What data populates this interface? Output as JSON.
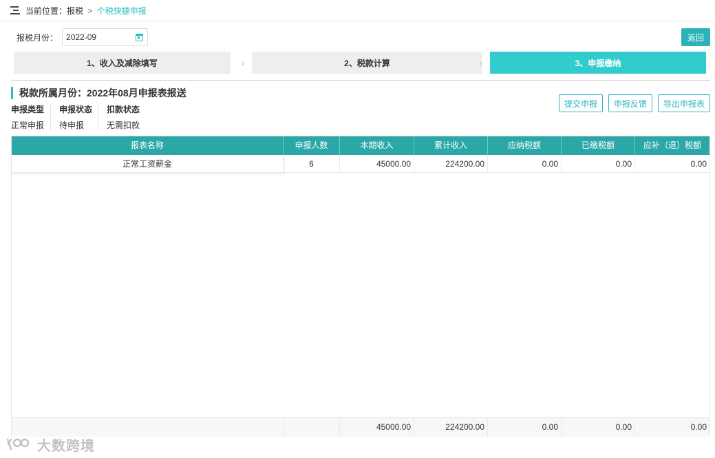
{
  "breadcrumb": {
    "prefix": "当前位置：报税",
    "separator": ">",
    "current": "个税快捷申报"
  },
  "filter": {
    "month_label": "报税月份：",
    "month_value": "2022-09"
  },
  "back_button": "返回",
  "steps": [
    {
      "label": "1、收入及减除填写",
      "active": false
    },
    {
      "label": "2、税款计算",
      "active": false
    },
    {
      "label": "3、申报缴纳",
      "active": true
    }
  ],
  "section": {
    "title": "税款所属月份：2022年08月申报表报送"
  },
  "status": [
    {
      "header": "申报类型",
      "value": "正常申报"
    },
    {
      "header": "申报状态",
      "value": "待申报"
    },
    {
      "header": "扣款状态",
      "value": "无需扣款"
    }
  ],
  "actions": {
    "submit": "提交申报",
    "feedback": "申报反馈",
    "export": "导出申报表"
  },
  "table": {
    "columns": [
      "报表名称",
      "申报人数",
      "本期收入",
      "累计收入",
      "应纳税额",
      "已缴税额",
      "应补（退）税额"
    ],
    "rows": [
      [
        "正常工资薪金",
        "6",
        "45000.00",
        "224200.00",
        "0.00",
        "0.00",
        "0.00"
      ]
    ],
    "footer": [
      "",
      "",
      "45000.00",
      "224200.00",
      "0.00",
      "0.00",
      "0.00"
    ]
  },
  "watermark": "大数跨境",
  "colors": {
    "accent": "#2bb8bf",
    "table_header": "#2ba7a8",
    "active_step": "#33cccc"
  }
}
